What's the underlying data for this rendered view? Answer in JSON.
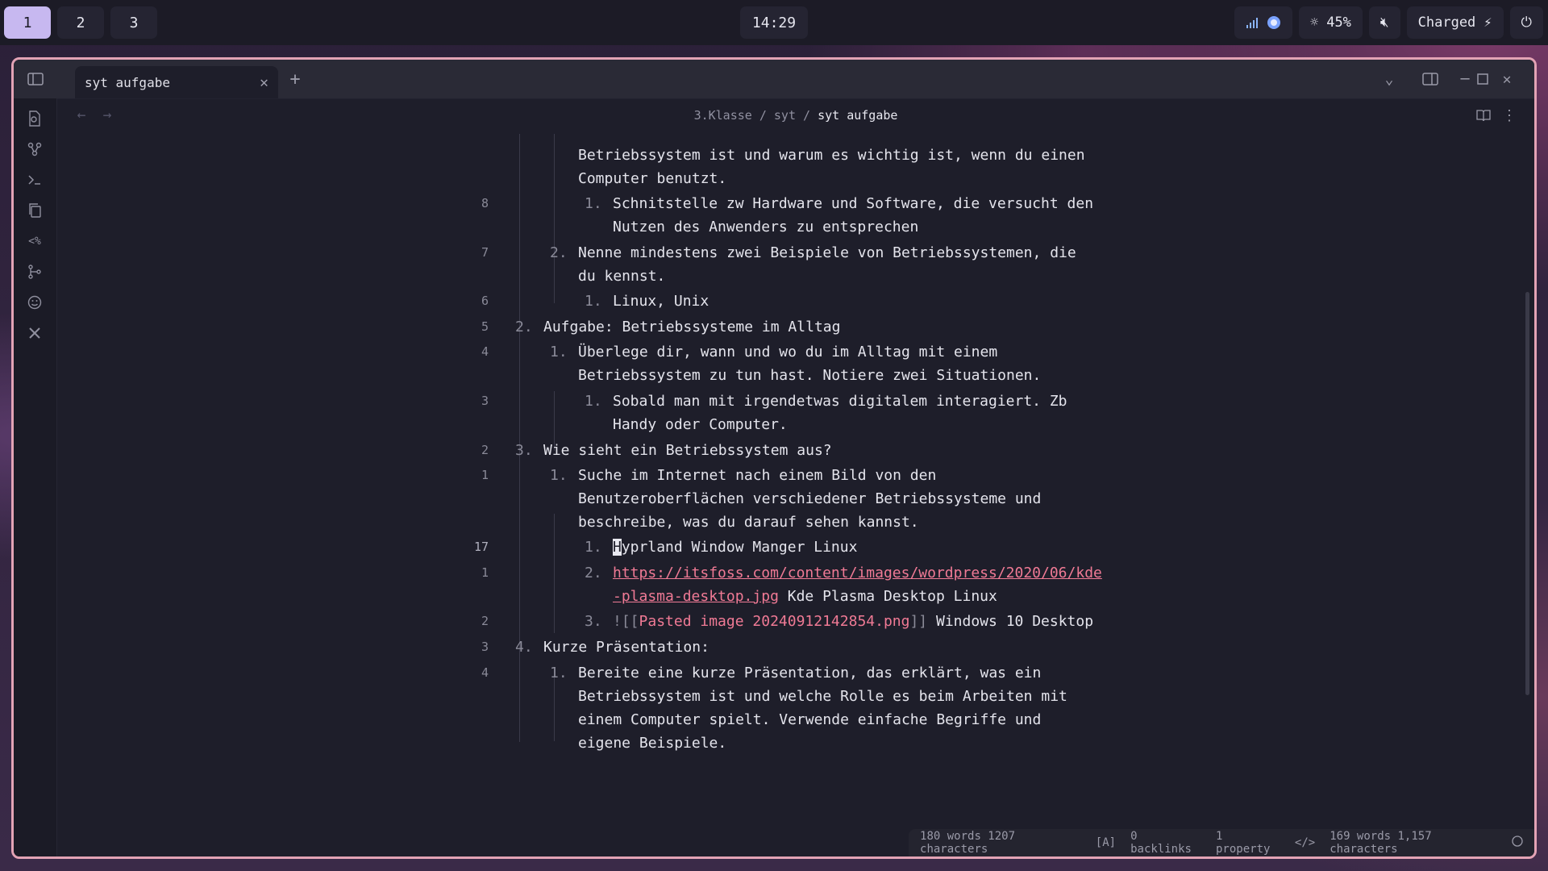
{
  "topbar": {
    "workspaces": [
      {
        "label": "1",
        "active": true
      },
      {
        "label": "2",
        "active": false
      },
      {
        "label": "3",
        "active": false
      }
    ],
    "clock": "14:29",
    "brightness": "45%",
    "battery": "Charged"
  },
  "tab": {
    "title": "syt aufgabe"
  },
  "breadcrumb": {
    "part1": "3.Klasse",
    "sep": "/",
    "part2": "syt",
    "current": "syt aufgabe"
  },
  "editor": {
    "lines": [
      {
        "num": "",
        "marker": "",
        "text": "Betriebssystem ist und warum es wichtig ist, wenn du einen"
      },
      {
        "num": "",
        "marker": "",
        "text": "Computer benutzt."
      },
      {
        "num": "8",
        "marker": "1.",
        "text": "Schnitstelle zw Hardware und Software, die versucht den"
      },
      {
        "num": "",
        "marker": "",
        "text": "Nutzen des Anwenders zu entsprechen"
      },
      {
        "num": "7",
        "marker": "2.",
        "text": "Nenne mindestens zwei Beispiele von Betriebssystemen, die"
      },
      {
        "num": "",
        "marker": "",
        "text": "du kennst."
      },
      {
        "num": "6",
        "marker": "1.",
        "text": "Linux, Unix"
      },
      {
        "num": "5",
        "marker": "2.",
        "text": "Aufgabe: Betriebssysteme im Alltag"
      },
      {
        "num": "4",
        "marker": "1.",
        "text": "Überlege dir, wann und wo du im Alltag mit einem"
      },
      {
        "num": "",
        "marker": "",
        "text": "Betriebssystem zu tun hast. Notiere zwei Situationen."
      },
      {
        "num": "3",
        "marker": "1.",
        "text": "Sobald man mit irgendetwas digitalem interagiert. Zb"
      },
      {
        "num": "",
        "marker": "",
        "text": "Handy oder Computer."
      },
      {
        "num": "2",
        "marker": "3.",
        "text": "Wie sieht ein Betriebssystem aus?"
      },
      {
        "num": "1",
        "marker": "1.",
        "text": "Suche im Internet nach einem Bild von den"
      },
      {
        "num": "",
        "marker": "",
        "text": "Benutzeroberflächen verschiedener Betriebssysteme und"
      },
      {
        "num": "",
        "marker": "",
        "text": "beschreibe, was du darauf sehen kannst."
      },
      {
        "num": "17",
        "marker": "1.",
        "cursor_char": "H",
        "text": "yprland Window Manger Linux"
      },
      {
        "num": "1",
        "marker": "2.",
        "link": "https://itsfoss.com/content/images/wordpress/2020/06/kde"
      },
      {
        "num": "",
        "marker": "",
        "link": "-plasma-desktop.jpg",
        "text": " Kde Plasma Desktop Linux"
      },
      {
        "num": "2",
        "marker": "3.",
        "embed_open": "![[",
        "embed": "Pasted image 20240912142854.png",
        "embed_close": "]]",
        "text": " Windows 10 Desktop"
      },
      {
        "num": "3",
        "marker": "4.",
        "text": "Kurze Präsentation:"
      },
      {
        "num": "4",
        "marker": "1.",
        "text": "Bereite eine kurze Präsentation, das erklärt, was ein"
      },
      {
        "num": "",
        "marker": "",
        "text": "Betriebssystem ist und welche Rolle es beim Arbeiten mit"
      },
      {
        "num": "",
        "marker": "",
        "text": "einem Computer spielt. Verwende einfache Begriffe und"
      },
      {
        "num": "",
        "marker": "",
        "text": "eigene Beispiele."
      }
    ]
  },
  "statusbar": {
    "words_chars": "180 words 1207 characters",
    "mode": "[A]",
    "backlinks": "0 backlinks",
    "properties": "1 property",
    "code_icon": "</>",
    "selection_count": "169 words 1,157 characters"
  }
}
